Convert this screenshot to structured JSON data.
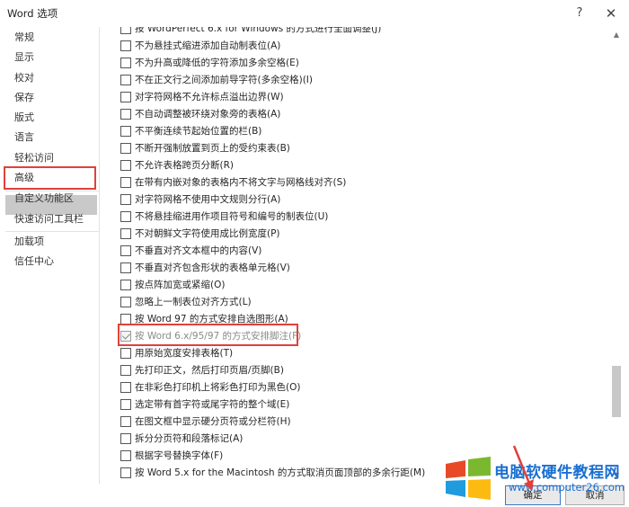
{
  "window": {
    "title": "Word 选项",
    "help_icon": "?",
    "close_icon": "✕"
  },
  "sidebar": {
    "items": [
      {
        "label": "常规"
      },
      {
        "label": "显示"
      },
      {
        "label": "校对"
      },
      {
        "label": "保存"
      },
      {
        "label": "版式"
      },
      {
        "label": "语言"
      },
      {
        "label": "轻松访问"
      },
      {
        "label": "高级",
        "selected": true
      },
      {
        "label": "自定义功能区"
      },
      {
        "label": "快速访问工具栏"
      },
      {
        "label": "加载项"
      },
      {
        "label": "信任中心"
      }
    ]
  },
  "options": [
    {
      "label": "按 WordPerfect 6.x for Windows 的方式进行全面调整(J)",
      "checked": false
    },
    {
      "label": "不为悬挂式缩进添加自动制表位(A)",
      "checked": false
    },
    {
      "label": "不为升高或降低的字符添加多余空格(E)",
      "checked": false
    },
    {
      "label": "不在正文行之间添加前导字符(多余空格)(I)",
      "checked": false
    },
    {
      "label": "对字符网格不允许标点溢出边界(W)",
      "checked": false
    },
    {
      "label": "不自动调整被环绕对象旁的表格(A)",
      "checked": false
    },
    {
      "label": "不平衡连续节起始位置的栏(B)",
      "checked": false
    },
    {
      "label": "不断开强制放置到页上的受约束表(B)",
      "checked": false
    },
    {
      "label": "不允许表格跨页分断(R)",
      "checked": false
    },
    {
      "label": "在带有内嵌对象的表格内不将文字与网格线对齐(S)",
      "checked": false
    },
    {
      "label": "对字符网格不使用中文规则分行(A)",
      "checked": false
    },
    {
      "label": "不将悬挂缩进用作项目符号和编号的制表位(U)",
      "checked": false
    },
    {
      "label": "不对朝鲜文字符使用成比例宽度(P)",
      "checked": false
    },
    {
      "label": "不垂直对齐文本框中的内容(V)",
      "checked": false
    },
    {
      "label": "不垂直对齐包含形状的表格单元格(V)",
      "checked": false
    },
    {
      "label": "按点阵加宽或紧缩(O)",
      "checked": false
    },
    {
      "label": "忽略上一制表位对齐方式(L)",
      "checked": false
    },
    {
      "label": "按 Word 97 的方式安排自选图形(A)",
      "checked": false
    },
    {
      "label": "按 Word 6.x/95/97 的方式安排脚注(F)",
      "checked": true,
      "disabled": true
    },
    {
      "label": "用原始宽度安排表格(T)",
      "checked": false
    },
    {
      "label": "先打印正文，然后打印页眉/页脚(B)",
      "checked": false
    },
    {
      "label": "在非彩色打印机上将彩色打印为黑色(O)",
      "checked": false
    },
    {
      "label": "选定带有首字符或尾字符的整个域(E)",
      "checked": false
    },
    {
      "label": "在图文框中显示硬分页符或分栏符(H)",
      "checked": false
    },
    {
      "label": "拆分分页符和段落标记(A)",
      "checked": false
    },
    {
      "label": "根据字号替换字体(F)",
      "checked": false
    },
    {
      "label": "按 Word 5.x for the Macintosh 的方式取消页面顶部的多余行距(M)",
      "checked": false
    }
  ],
  "buttons": {
    "ok": "确定",
    "cancel": "取消"
  },
  "watermark": {
    "name": "电脑软硬件教程网",
    "url": "www.computer26.com"
  },
  "colors": {
    "highlight_red": "#e0413a",
    "selected_nav": "#c9c9c9",
    "watermark_blue": "#1a6fd0"
  }
}
